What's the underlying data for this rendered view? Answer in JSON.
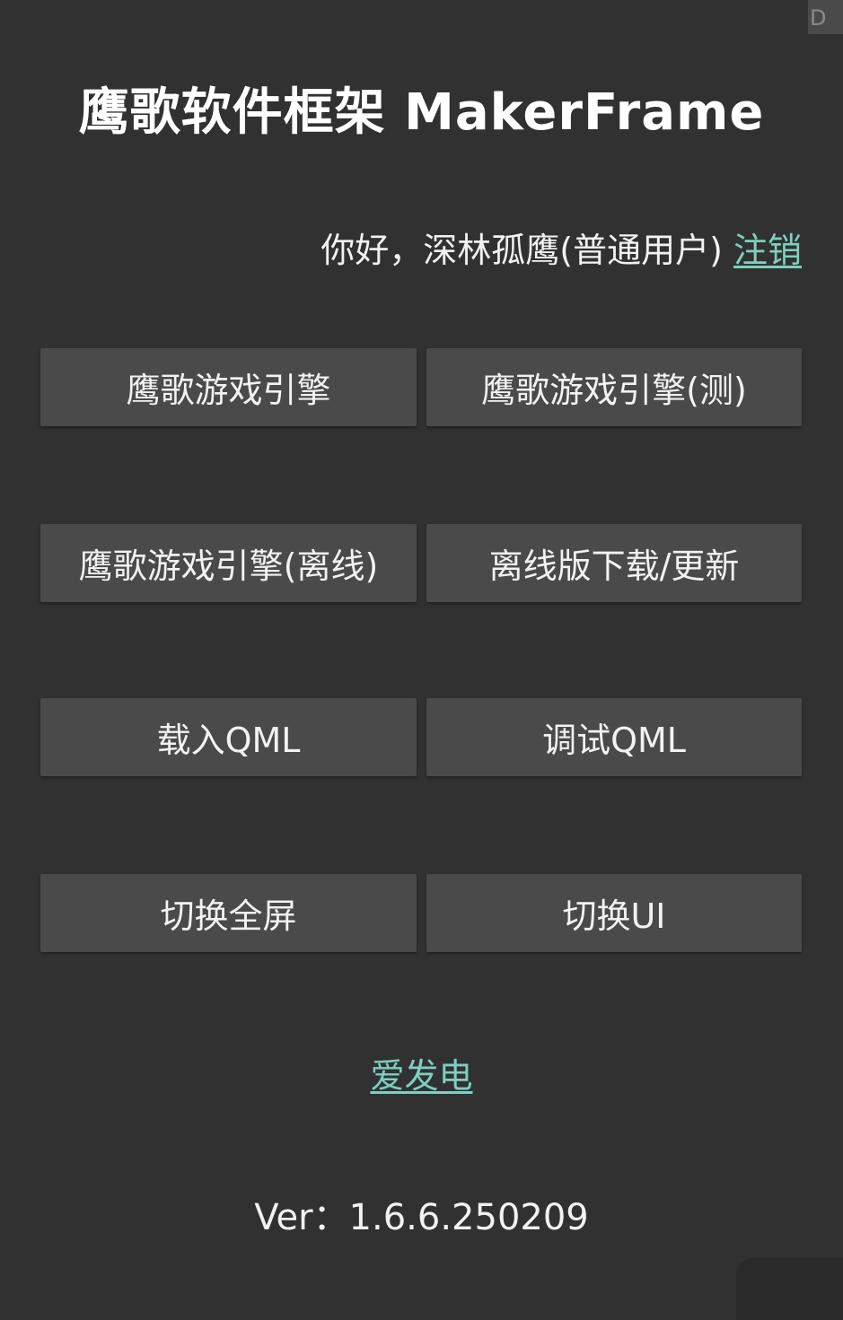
{
  "debug_badge": "D",
  "header": {
    "title": "鹰歌软件框架 MakerFrame"
  },
  "user": {
    "greeting": "你好，深林孤鹰(普通用户) ",
    "logout_label": "注销"
  },
  "buttons": {
    "game_engine": "鹰歌游戏引擎",
    "game_engine_test": "鹰歌游戏引擎(测)",
    "game_engine_offline": "鹰歌游戏引擎(离线)",
    "offline_download": "离线版下载/更新",
    "load_qml": "载入QML",
    "debug_qml": "调试QML",
    "toggle_fullscreen": "切换全屏",
    "toggle_ui": "切换UI"
  },
  "footer": {
    "donate_label": "爱发电",
    "version": "Ver：1.6.6.250209"
  },
  "colors": {
    "background": "#313131",
    "button": "#4a4a4a",
    "link": "#7fcfc0"
  }
}
